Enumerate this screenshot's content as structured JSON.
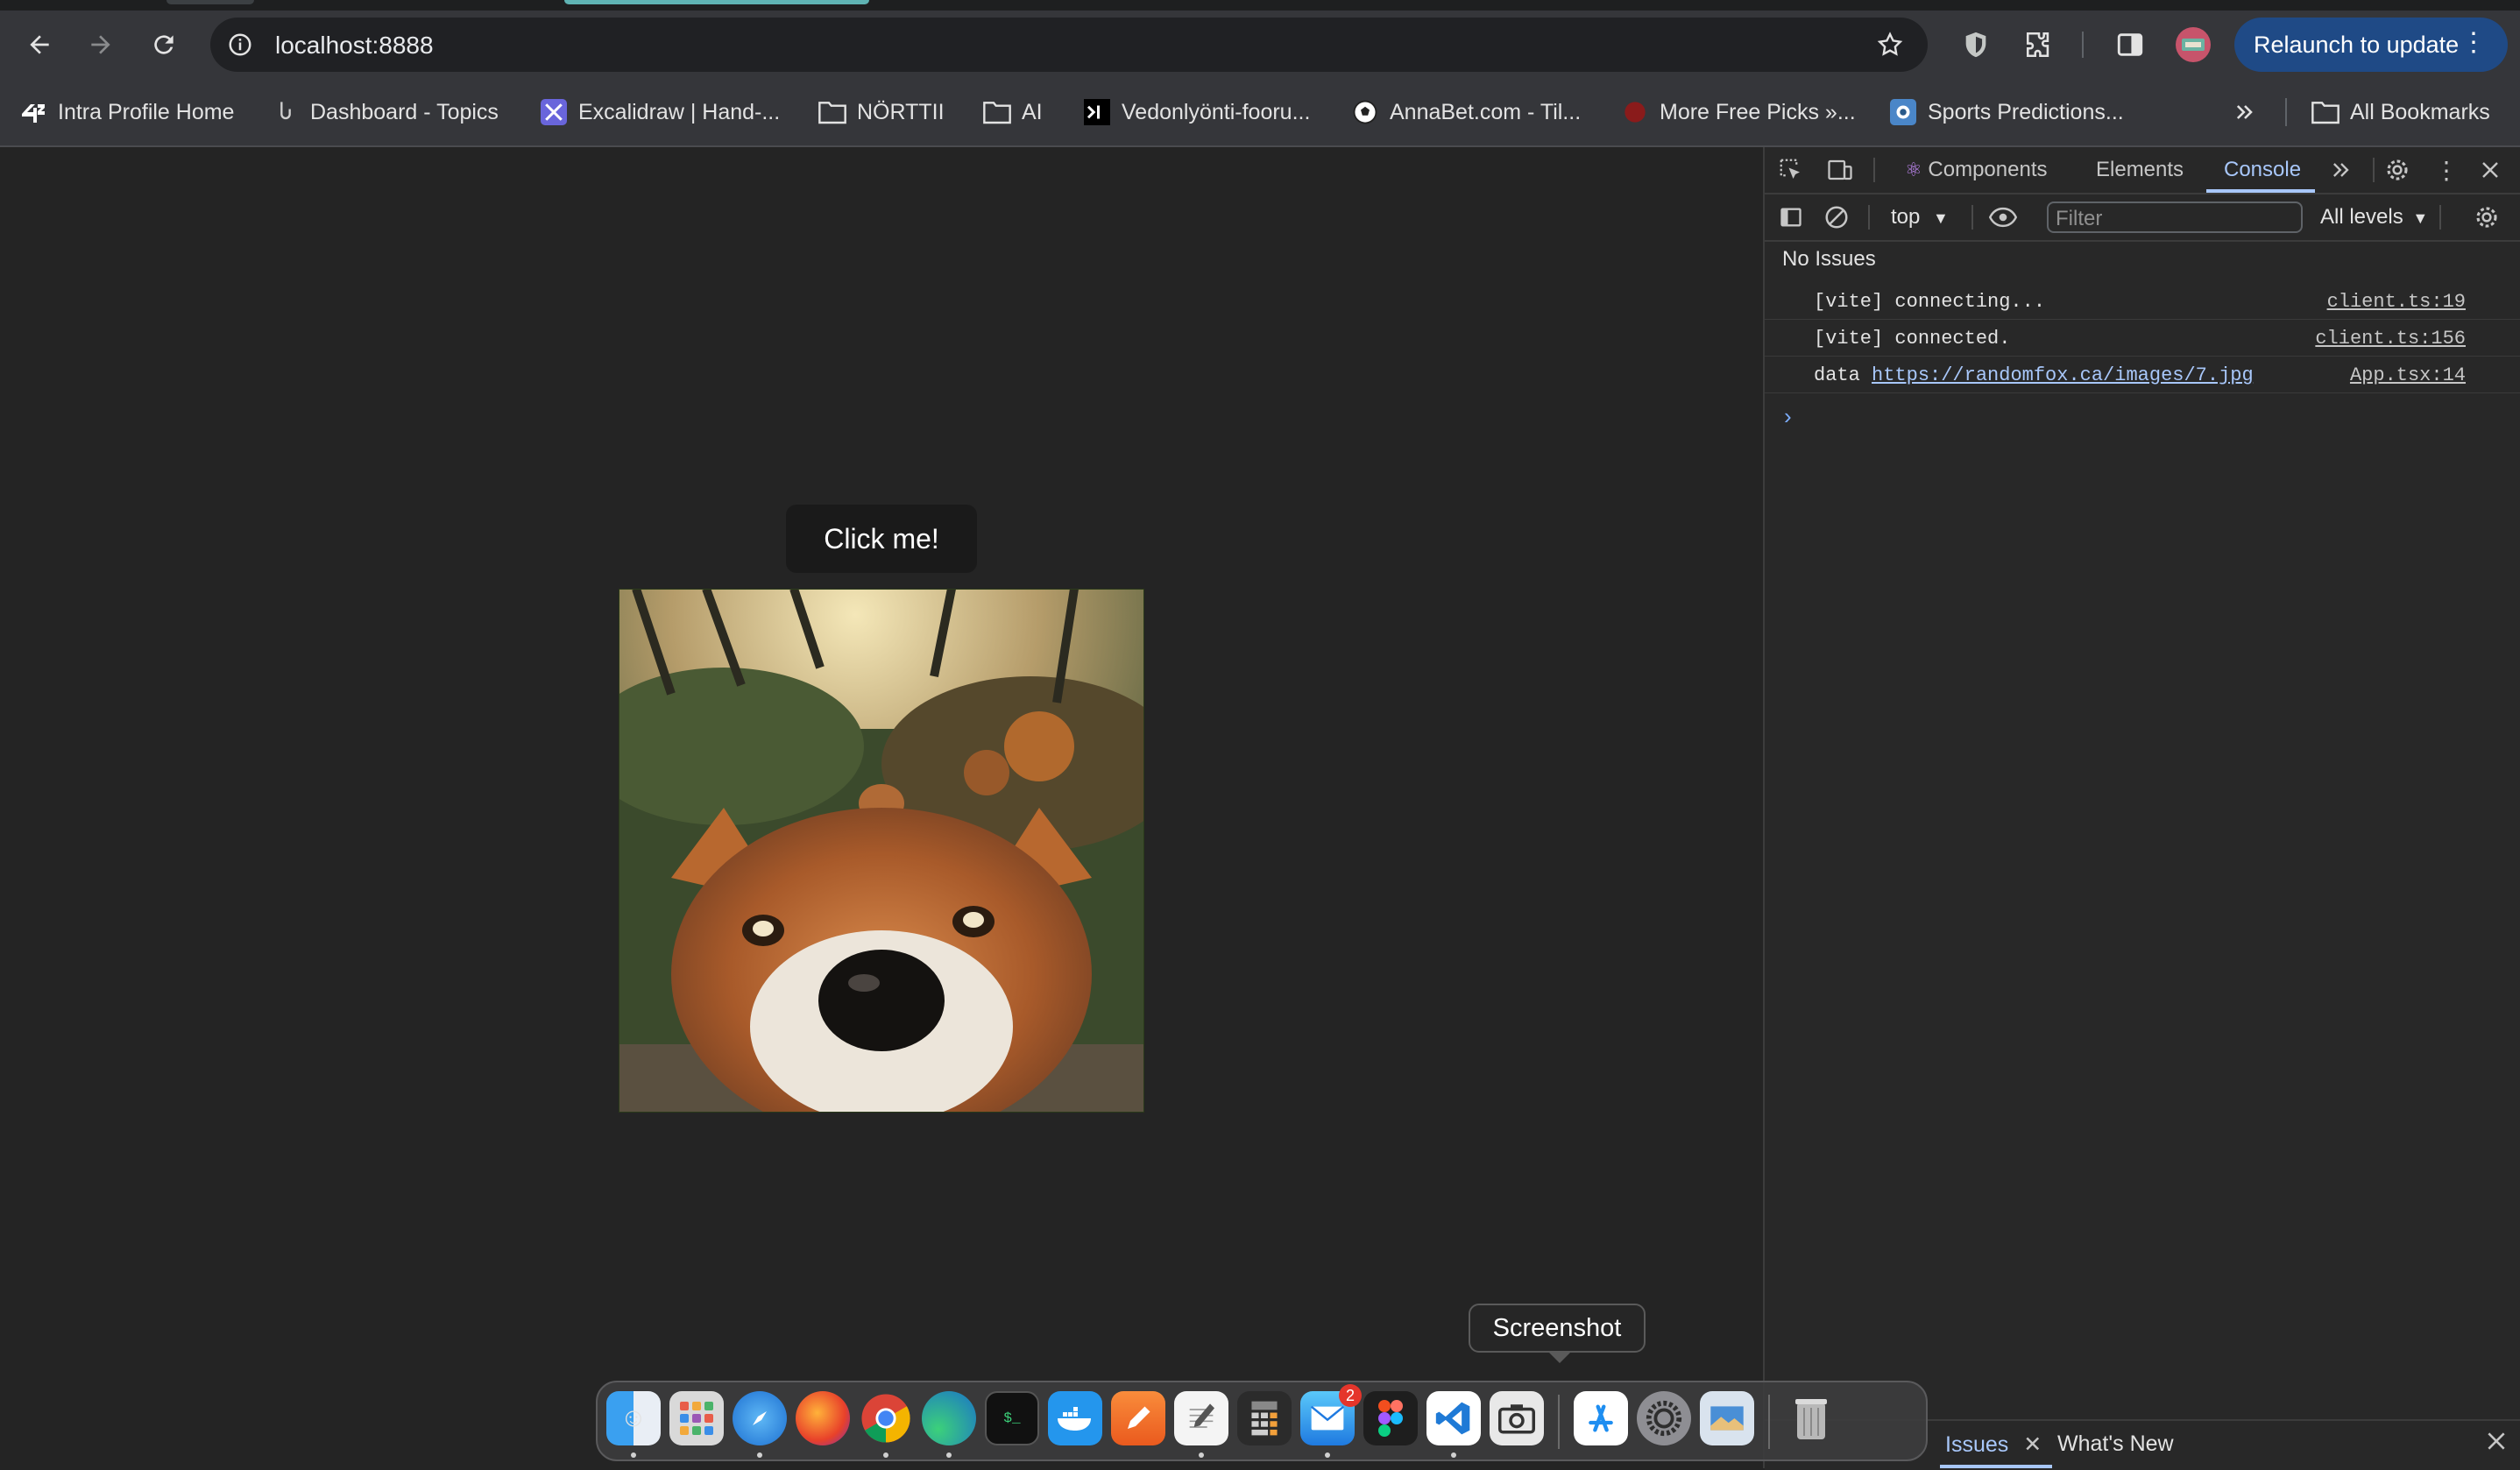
{
  "browser": {
    "url": "localhost:8888",
    "relaunch_label": "Relaunch to update",
    "bookmarks": [
      {
        "label": "Intra Profile Home",
        "icon": "intra-icon"
      },
      {
        "label": "Dashboard - Topics",
        "icon": "dashboard-icon"
      },
      {
        "label": "Excalidraw | Hand-...",
        "icon": "excalidraw-icon"
      },
      {
        "label": "NÖRTTII",
        "icon": "folder-icon"
      },
      {
        "label": "AI",
        "icon": "folder-icon"
      },
      {
        "label": "Vedonlyönti-fooru...",
        "icon": "terminal-icon"
      },
      {
        "label": "AnnaBet.com - Til...",
        "icon": "soccer-ball-icon"
      },
      {
        "label": "More Free Picks »...",
        "icon": "picks-icon"
      },
      {
        "label": "Sports Predictions...",
        "icon": "predictions-icon"
      }
    ],
    "all_bookmarks_label": "All Bookmarks"
  },
  "page": {
    "button_label": "Click me!",
    "image_subject": "fox close-up photo"
  },
  "devtools": {
    "tabs": {
      "components": "Components",
      "elements": "Elements",
      "console": "Console"
    },
    "context": "top",
    "filter_placeholder": "Filter",
    "levels": "All levels",
    "no_issues": "No Issues",
    "console_lines": [
      {
        "message": "[vite] connecting...",
        "source": "client.ts:19"
      },
      {
        "message": "[vite] connected.",
        "source": "client.ts:156"
      },
      {
        "message_prefix": "data",
        "link": "https://randomfox.ca/images/7.jpg",
        "source": "App.tsx:14"
      }
    ],
    "drawer_tabs": {
      "issues": "Issues",
      "whats_new": "What's New"
    }
  },
  "dock": {
    "tooltip": "Screenshot",
    "mail_badge": "2",
    "apps": [
      "Finder",
      "Launchpad",
      "Safari",
      "Firefox",
      "Chrome",
      "Edge",
      "Terminal",
      "Docker",
      "Pages",
      "TextEdit",
      "Calculator",
      "Mail",
      "Figma",
      "VS Code",
      "Screenshot",
      "App Store",
      "System Settings",
      "Preview",
      "Trash"
    ]
  },
  "colors": {
    "page_bg": "#242424",
    "chrome_bg": "#35363a",
    "devtools_accent": "#a8c7fa",
    "relaunch_bg": "#1f4a86"
  }
}
